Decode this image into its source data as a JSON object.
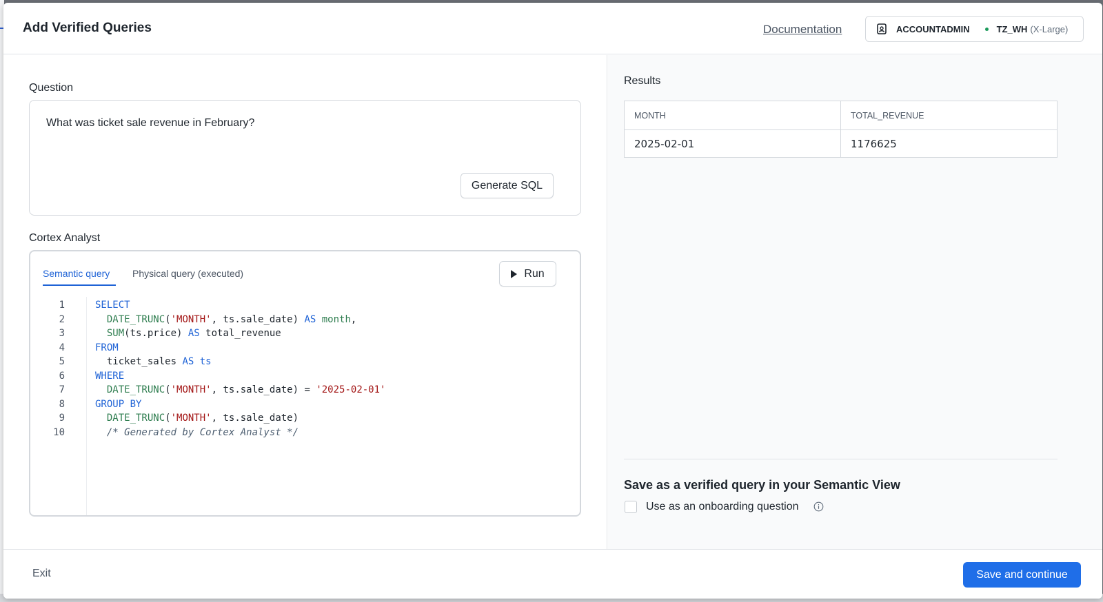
{
  "window": {
    "title": "Add Verified Queries",
    "documentation_link": "Documentation",
    "role": "ACCOUNTADMIN",
    "warehouse": "TZ_WH",
    "warehouse_size": "(X-Large)"
  },
  "question": {
    "label": "Question",
    "value": "What was ticket sale revenue in February?",
    "generate_button": "Generate SQL"
  },
  "analyst": {
    "label": "Cortex Analyst",
    "tabs": [
      {
        "label": "Semantic query",
        "active": true
      },
      {
        "label": "Physical query (executed)",
        "active": false
      }
    ],
    "run_button": "Run",
    "code_lines": [
      {
        "n": "1",
        "tokens": [
          {
            "t": "SELECT",
            "c": "kw"
          }
        ]
      },
      {
        "n": "2",
        "tokens": [
          {
            "t": "  DATE_TRUNC",
            "c": "fn"
          },
          {
            "t": "(",
            "c": "id"
          },
          {
            "t": "'MONTH'",
            "c": "str"
          },
          {
            "t": ", ts.sale_date) ",
            "c": "id"
          },
          {
            "t": "AS",
            "c": "kw"
          },
          {
            "t": " month",
            "c": "fn"
          },
          {
            "t": ",",
            "c": "id"
          }
        ]
      },
      {
        "n": "3",
        "tokens": [
          {
            "t": "  SUM",
            "c": "fn"
          },
          {
            "t": "(ts.price) ",
            "c": "id"
          },
          {
            "t": "AS",
            "c": "kw"
          },
          {
            "t": " total_revenue",
            "c": "id"
          }
        ]
      },
      {
        "n": "4",
        "tokens": [
          {
            "t": "FROM",
            "c": "kw"
          }
        ]
      },
      {
        "n": "5",
        "tokens": [
          {
            "t": "  ticket_sales ",
            "c": "id"
          },
          {
            "t": "AS",
            "c": "kw"
          },
          {
            "t": " ts",
            "c": "kw"
          }
        ]
      },
      {
        "n": "6",
        "tokens": [
          {
            "t": "WHERE",
            "c": "kw"
          }
        ]
      },
      {
        "n": "7",
        "tokens": [
          {
            "t": "  DATE_TRUNC",
            "c": "fn"
          },
          {
            "t": "(",
            "c": "id"
          },
          {
            "t": "'MONTH'",
            "c": "str"
          },
          {
            "t": ", ts.sale_date) = ",
            "c": "id"
          },
          {
            "t": "'2025-02-01'",
            "c": "str"
          }
        ]
      },
      {
        "n": "8",
        "tokens": [
          {
            "t": "GROUP BY",
            "c": "kw"
          }
        ]
      },
      {
        "n": "9",
        "tokens": [
          {
            "t": "  DATE_TRUNC",
            "c": "fn"
          },
          {
            "t": "(",
            "c": "id"
          },
          {
            "t": "'MONTH'",
            "c": "str"
          },
          {
            "t": ", ts.sale_date)",
            "c": "id"
          }
        ]
      },
      {
        "n": "10",
        "tokens": [
          {
            "t": "  /* Generated by Cortex Analyst */",
            "c": "cm"
          }
        ]
      }
    ]
  },
  "results": {
    "label": "Results",
    "columns": [
      "MONTH",
      "TOTAL_REVENUE"
    ],
    "rows": [
      [
        "2025-02-01",
        "1176625"
      ]
    ]
  },
  "save_section": {
    "title": "Save as a verified query in your Semantic View",
    "onboarding_label": "Use as an onboarding question",
    "onboarding_checked": false
  },
  "footer": {
    "exit": "Exit",
    "save": "Save and continue"
  },
  "colors": {
    "accent": "#1f6ee8",
    "keyword": "#1f63d6",
    "function": "#2e7d4f",
    "string": "#a31515",
    "status_dot": "#1a9a5a"
  }
}
